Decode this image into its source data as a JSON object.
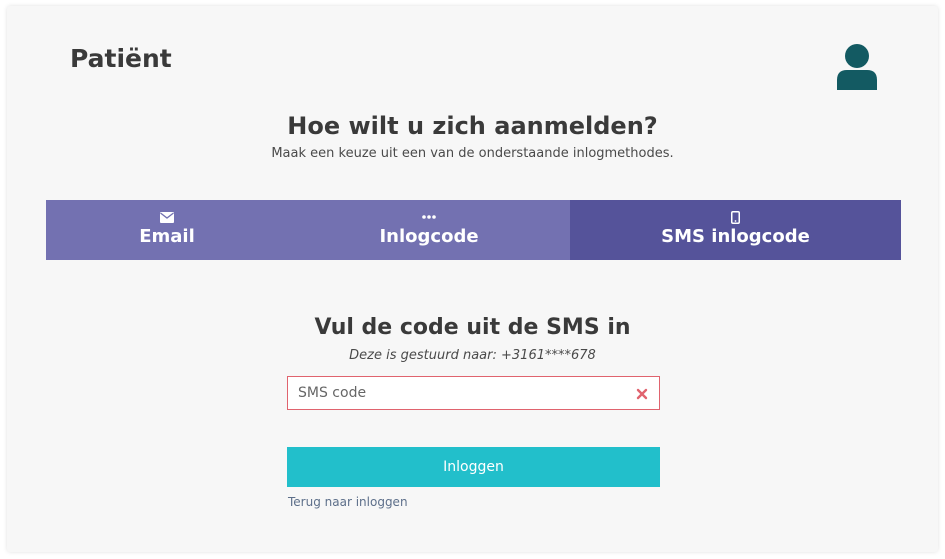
{
  "header": {
    "title": "Patiënt",
    "avatar_icon": "user-icon",
    "avatar_color": "#135a62"
  },
  "intro": {
    "heading": "Hoe wilt u zich aanmelden?",
    "subheading": "Maak een keuze uit een van de onderstaande inlogmethodes."
  },
  "tabs": [
    {
      "label": "Email",
      "icon": "envelope-icon",
      "active": false
    },
    {
      "label": "Inlogcode",
      "icon": "dots-icon",
      "active": false
    },
    {
      "label": "SMS inlogcode",
      "icon": "mobile-phone-icon",
      "active": true
    }
  ],
  "form": {
    "title": "Vul de code uit de SMS in",
    "note": "Deze is gestuurd naar: +3161****678",
    "input_placeholder": "SMS code",
    "input_value": "",
    "clear_icon": "close-icon",
    "submit_label": "Inloggen",
    "back_link": "Terug naar inloggen"
  },
  "colors": {
    "tab_inactive": "#7371b1",
    "tab_active": "#55539a",
    "button": "#22bfcb",
    "input_error_border": "#e0636e",
    "clear_icon": "#e0636e",
    "link": "#5d6f8a"
  }
}
